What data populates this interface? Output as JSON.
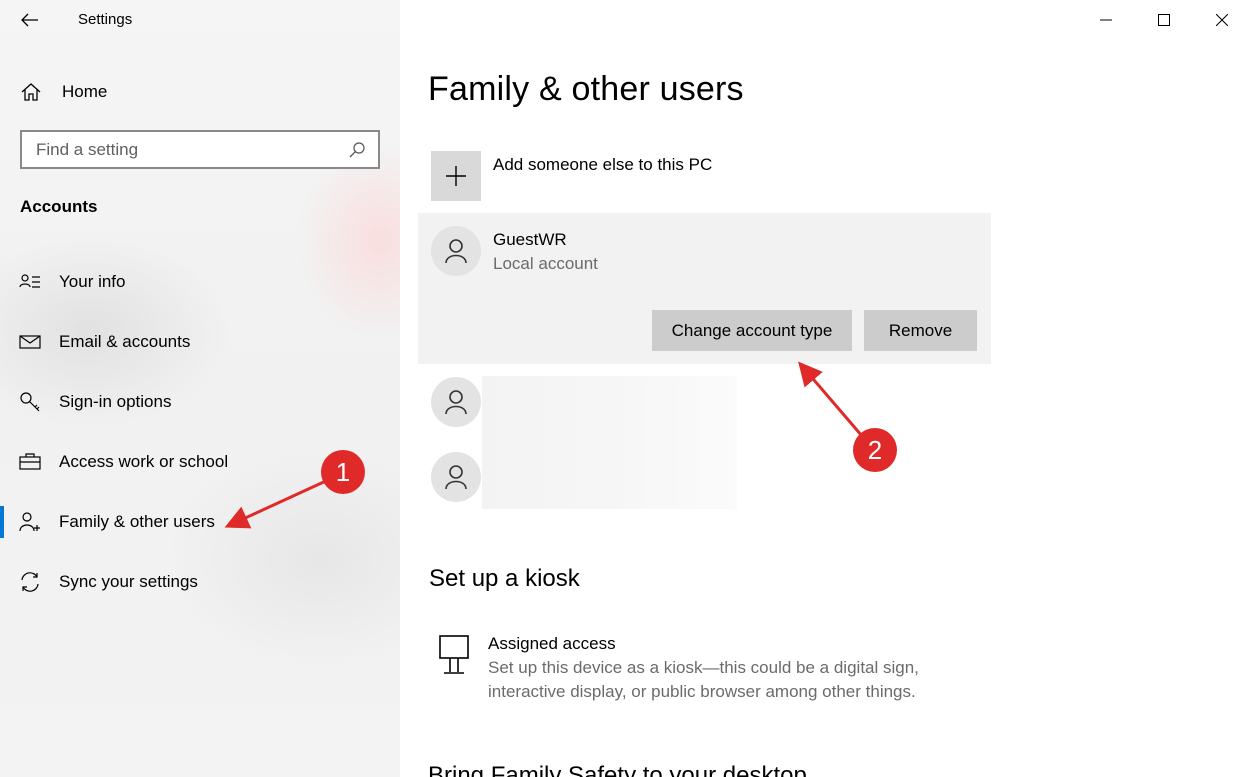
{
  "window": {
    "title": "Settings"
  },
  "sidebar": {
    "home_label": "Home",
    "search_placeholder": "Find a setting",
    "section_title": "Accounts",
    "items": [
      {
        "label": "Your info",
        "icon": "contact-card-icon"
      },
      {
        "label": "Email & accounts",
        "icon": "mail-icon"
      },
      {
        "label": "Sign-in options",
        "icon": "key-icon"
      },
      {
        "label": "Access work or school",
        "icon": "briefcase-icon"
      },
      {
        "label": "Family & other users",
        "icon": "add-person-icon",
        "active": true
      },
      {
        "label": "Sync your settings",
        "icon": "sync-icon"
      }
    ]
  },
  "main": {
    "title": "Family & other users",
    "add_user_label": "Add someone else to this PC",
    "selected_user": {
      "name": "GuestWR",
      "type": "Local account",
      "change_button": "Change account type",
      "remove_button": "Remove"
    },
    "kiosk": {
      "title": "Set up a kiosk",
      "item_name": "Assigned access",
      "item_desc": "Set up this device as a kiosk—this could be a digital sign, interactive display, or public browser among other things."
    },
    "cut_heading": "Bring Family Safety to your desktop"
  },
  "annotations": {
    "badge_1": "1",
    "badge_2": "2",
    "color": "#e02a2a"
  },
  "colors": {
    "accent": "#0078d7",
    "button_gray": "#cccccc",
    "card_bg": "#f2f2f2"
  }
}
